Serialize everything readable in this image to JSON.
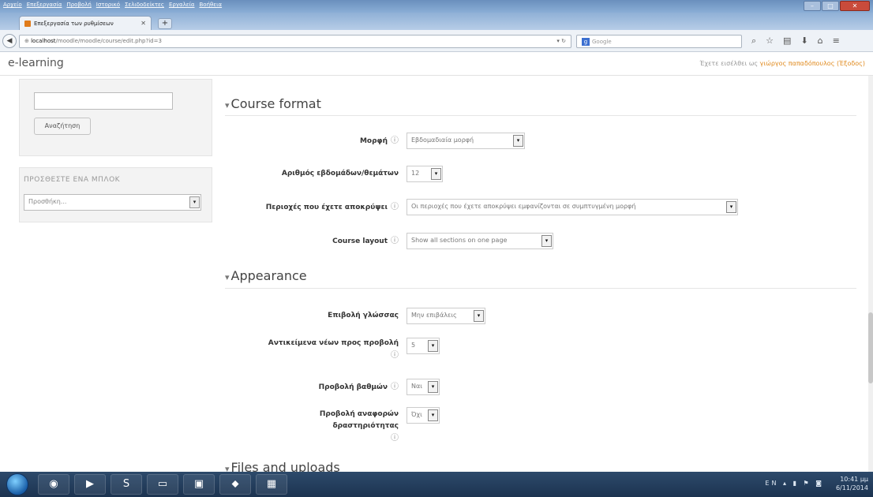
{
  "browser": {
    "menu": [
      "Αρχείο",
      "Επεξεργασία",
      "Προβολή",
      "Ιστορικό",
      "Σελιδοδείκτες",
      "Εργαλεία",
      "Βοήθεια"
    ],
    "tab_title": "Επεξεργασία των ρυθμίσεων",
    "url_host": "localhost",
    "url_path": "/moodle/moodle/course/edit.php?id=3",
    "search_placeholder": "Google"
  },
  "header": {
    "site_name": "e-learning",
    "login_prefix": "Έχετε εισέλθει ως",
    "user_name": "γιώργος παπαδόπουλος",
    "logout": "(Έξοδος)"
  },
  "sidebar": {
    "search_button": "Αναζήτηση",
    "add_block_title": "ΠΡΟΣΘΕΣΤΕ ΕΝΑ ΜΠΛΟΚ",
    "add_block_select": "Προσθήκη..."
  },
  "form": {
    "sections": [
      {
        "title": "Course format"
      },
      {
        "title": "Appearance"
      },
      {
        "title": "Files and uploads"
      }
    ],
    "fields": [
      {
        "label": "Μορφή",
        "value": "Εβδομαδιαία μορφή"
      },
      {
        "label": "Αριθμός εβδομάδων/θεμάτων",
        "value": "12"
      },
      {
        "label": "Περιοχές που έχετε αποκρύψει",
        "value": "Οι περιοχές που έχετε αποκρύψει εμφανίζονται σε συμπτυγμένη μορφή"
      },
      {
        "label": "Course layout",
        "value": "Show all sections on one page"
      },
      {
        "label": "Επιβολή γλώσσας",
        "value": "Μην επιβάλεις"
      },
      {
        "label": "Αντικείμενα νέων προς προβολή",
        "value": "5"
      },
      {
        "label": "Προβολή βαθμών",
        "value": "Ναι"
      },
      {
        "label": "Προβολή αναφορών δραστηριότητας",
        "value": "Όχι"
      }
    ]
  },
  "taskbar": {
    "tray_lang": "EN",
    "time": "10:41 μμ",
    "date": "6/11/2014"
  }
}
